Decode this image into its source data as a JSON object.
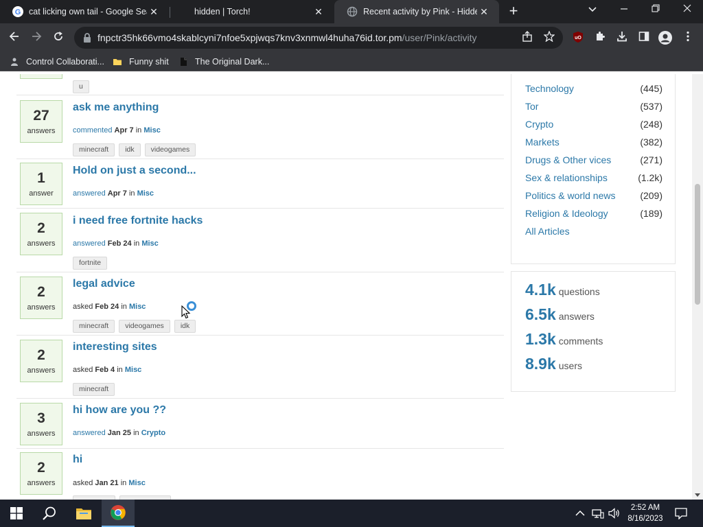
{
  "browser": {
    "tabs": [
      {
        "title": "cat licking own tail - Google Sear",
        "close": "✕",
        "favicon": "google-icon"
      },
      {
        "title": "hidden | Torch!",
        "close": "✕",
        "favicon": "none"
      },
      {
        "title": "Recent activity by Pink - Hidden /",
        "close": "✕",
        "favicon": "globe-icon"
      }
    ],
    "new_tab": "+",
    "url_host": "fnpctr35hk66vmo4skablcyni7nfoe5xpjwqs7knv3xnmwl4huha76id.tor.pm",
    "url_path": "/user/Pink/activity",
    "bookmarks": [
      {
        "label": "Control Collaborati..."
      },
      {
        "label": "Funny shit"
      },
      {
        "label": "The Original Dark..."
      }
    ]
  },
  "page": {
    "partial_top": {
      "tag": "u"
    },
    "questions": [
      {
        "count": "27",
        "count_label": "answers",
        "title": "ask me anything",
        "action": "commented",
        "date": "Apr 7",
        "in": "in",
        "category": "Misc",
        "tags": [
          "minecraft",
          "idk",
          "videogames"
        ]
      },
      {
        "count": "1",
        "count_label": "answer",
        "title": "Hold on just a second...",
        "action": "answered",
        "date": "Apr 7",
        "in": "in",
        "category": "Misc",
        "tags": []
      },
      {
        "count": "2",
        "count_label": "answers",
        "title": "i need free fortnite hacks",
        "action": "answered",
        "date": "Feb 24",
        "in": "in",
        "category": "Misc",
        "tags": [
          "fortnite"
        ]
      },
      {
        "count": "2",
        "count_label": "answers",
        "title": "legal advice",
        "action": "asked",
        "date": "Feb 24",
        "in": "in",
        "category": "Misc",
        "tags": [
          "minecraft",
          "videogames",
          "idk"
        ]
      },
      {
        "count": "2",
        "count_label": "answers",
        "title": "interesting sites",
        "action": "asked",
        "date": "Feb 4",
        "in": "in",
        "category": "Misc",
        "tags": [
          "minecraft"
        ]
      },
      {
        "count": "3",
        "count_label": "answers",
        "title": "hi how are you ??",
        "action": "answered",
        "date": "Jan 25",
        "in": "in",
        "category": "Crypto",
        "tags": []
      },
      {
        "count": "2",
        "count_label": "answers",
        "title": "hi",
        "action": "asked",
        "date": "Jan 21",
        "in": "in",
        "category": "Misc",
        "tags": []
      }
    ],
    "categories": [
      {
        "name": "Technology",
        "count": "(445)"
      },
      {
        "name": "Tor",
        "count": "(537)"
      },
      {
        "name": "Crypto",
        "count": "(248)"
      },
      {
        "name": "Markets",
        "count": "(382)"
      },
      {
        "name": "Drugs & Other vices",
        "count": "(271)"
      },
      {
        "name": "Sex & relationships",
        "count": "(1.2k)"
      },
      {
        "name": "Politics & world news",
        "count": "(209)"
      },
      {
        "name": "Religion & Ideology",
        "count": "(189)"
      }
    ],
    "all_articles": "All Articles",
    "stats": [
      {
        "value": "4.1k",
        "label": "questions"
      },
      {
        "value": "6.5k",
        "label": "answers"
      },
      {
        "value": "1.3k",
        "label": "comments"
      },
      {
        "value": "8.9k",
        "label": "users"
      }
    ]
  },
  "taskbar": {
    "time": "2:52 AM",
    "date": "8/16/2023"
  }
}
